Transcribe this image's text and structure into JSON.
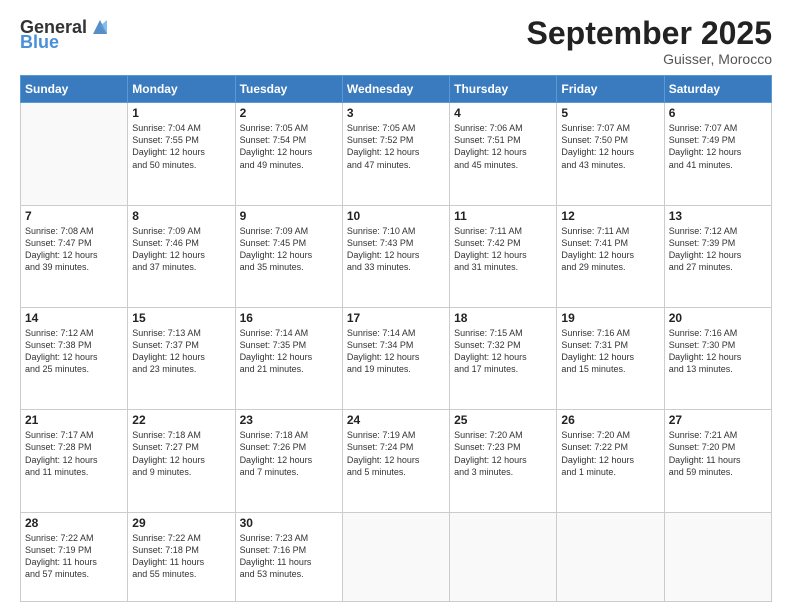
{
  "header": {
    "logo": {
      "general": "General",
      "blue": "Blue"
    },
    "title": "September 2025",
    "subtitle": "Guisser, Morocco"
  },
  "days_of_week": [
    "Sunday",
    "Monday",
    "Tuesday",
    "Wednesday",
    "Thursday",
    "Friday",
    "Saturday"
  ],
  "weeks": [
    [
      {
        "day": "",
        "info": ""
      },
      {
        "day": "1",
        "info": "Sunrise: 7:04 AM\nSunset: 7:55 PM\nDaylight: 12 hours\nand 50 minutes."
      },
      {
        "day": "2",
        "info": "Sunrise: 7:05 AM\nSunset: 7:54 PM\nDaylight: 12 hours\nand 49 minutes."
      },
      {
        "day": "3",
        "info": "Sunrise: 7:05 AM\nSunset: 7:52 PM\nDaylight: 12 hours\nand 47 minutes."
      },
      {
        "day": "4",
        "info": "Sunrise: 7:06 AM\nSunset: 7:51 PM\nDaylight: 12 hours\nand 45 minutes."
      },
      {
        "day": "5",
        "info": "Sunrise: 7:07 AM\nSunset: 7:50 PM\nDaylight: 12 hours\nand 43 minutes."
      },
      {
        "day": "6",
        "info": "Sunrise: 7:07 AM\nSunset: 7:49 PM\nDaylight: 12 hours\nand 41 minutes."
      }
    ],
    [
      {
        "day": "7",
        "info": "Sunrise: 7:08 AM\nSunset: 7:47 PM\nDaylight: 12 hours\nand 39 minutes."
      },
      {
        "day": "8",
        "info": "Sunrise: 7:09 AM\nSunset: 7:46 PM\nDaylight: 12 hours\nand 37 minutes."
      },
      {
        "day": "9",
        "info": "Sunrise: 7:09 AM\nSunset: 7:45 PM\nDaylight: 12 hours\nand 35 minutes."
      },
      {
        "day": "10",
        "info": "Sunrise: 7:10 AM\nSunset: 7:43 PM\nDaylight: 12 hours\nand 33 minutes."
      },
      {
        "day": "11",
        "info": "Sunrise: 7:11 AM\nSunset: 7:42 PM\nDaylight: 12 hours\nand 31 minutes."
      },
      {
        "day": "12",
        "info": "Sunrise: 7:11 AM\nSunset: 7:41 PM\nDaylight: 12 hours\nand 29 minutes."
      },
      {
        "day": "13",
        "info": "Sunrise: 7:12 AM\nSunset: 7:39 PM\nDaylight: 12 hours\nand 27 minutes."
      }
    ],
    [
      {
        "day": "14",
        "info": "Sunrise: 7:12 AM\nSunset: 7:38 PM\nDaylight: 12 hours\nand 25 minutes."
      },
      {
        "day": "15",
        "info": "Sunrise: 7:13 AM\nSunset: 7:37 PM\nDaylight: 12 hours\nand 23 minutes."
      },
      {
        "day": "16",
        "info": "Sunrise: 7:14 AM\nSunset: 7:35 PM\nDaylight: 12 hours\nand 21 minutes."
      },
      {
        "day": "17",
        "info": "Sunrise: 7:14 AM\nSunset: 7:34 PM\nDaylight: 12 hours\nand 19 minutes."
      },
      {
        "day": "18",
        "info": "Sunrise: 7:15 AM\nSunset: 7:32 PM\nDaylight: 12 hours\nand 17 minutes."
      },
      {
        "day": "19",
        "info": "Sunrise: 7:16 AM\nSunset: 7:31 PM\nDaylight: 12 hours\nand 15 minutes."
      },
      {
        "day": "20",
        "info": "Sunrise: 7:16 AM\nSunset: 7:30 PM\nDaylight: 12 hours\nand 13 minutes."
      }
    ],
    [
      {
        "day": "21",
        "info": "Sunrise: 7:17 AM\nSunset: 7:28 PM\nDaylight: 12 hours\nand 11 minutes."
      },
      {
        "day": "22",
        "info": "Sunrise: 7:18 AM\nSunset: 7:27 PM\nDaylight: 12 hours\nand 9 minutes."
      },
      {
        "day": "23",
        "info": "Sunrise: 7:18 AM\nSunset: 7:26 PM\nDaylight: 12 hours\nand 7 minutes."
      },
      {
        "day": "24",
        "info": "Sunrise: 7:19 AM\nSunset: 7:24 PM\nDaylight: 12 hours\nand 5 minutes."
      },
      {
        "day": "25",
        "info": "Sunrise: 7:20 AM\nSunset: 7:23 PM\nDaylight: 12 hours\nand 3 minutes."
      },
      {
        "day": "26",
        "info": "Sunrise: 7:20 AM\nSunset: 7:22 PM\nDaylight: 12 hours\nand 1 minute."
      },
      {
        "day": "27",
        "info": "Sunrise: 7:21 AM\nSunset: 7:20 PM\nDaylight: 11 hours\nand 59 minutes."
      }
    ],
    [
      {
        "day": "28",
        "info": "Sunrise: 7:22 AM\nSunset: 7:19 PM\nDaylight: 11 hours\nand 57 minutes."
      },
      {
        "day": "29",
        "info": "Sunrise: 7:22 AM\nSunset: 7:18 PM\nDaylight: 11 hours\nand 55 minutes."
      },
      {
        "day": "30",
        "info": "Sunrise: 7:23 AM\nSunset: 7:16 PM\nDaylight: 11 hours\nand 53 minutes."
      },
      {
        "day": "",
        "info": ""
      },
      {
        "day": "",
        "info": ""
      },
      {
        "day": "",
        "info": ""
      },
      {
        "day": "",
        "info": ""
      }
    ]
  ]
}
